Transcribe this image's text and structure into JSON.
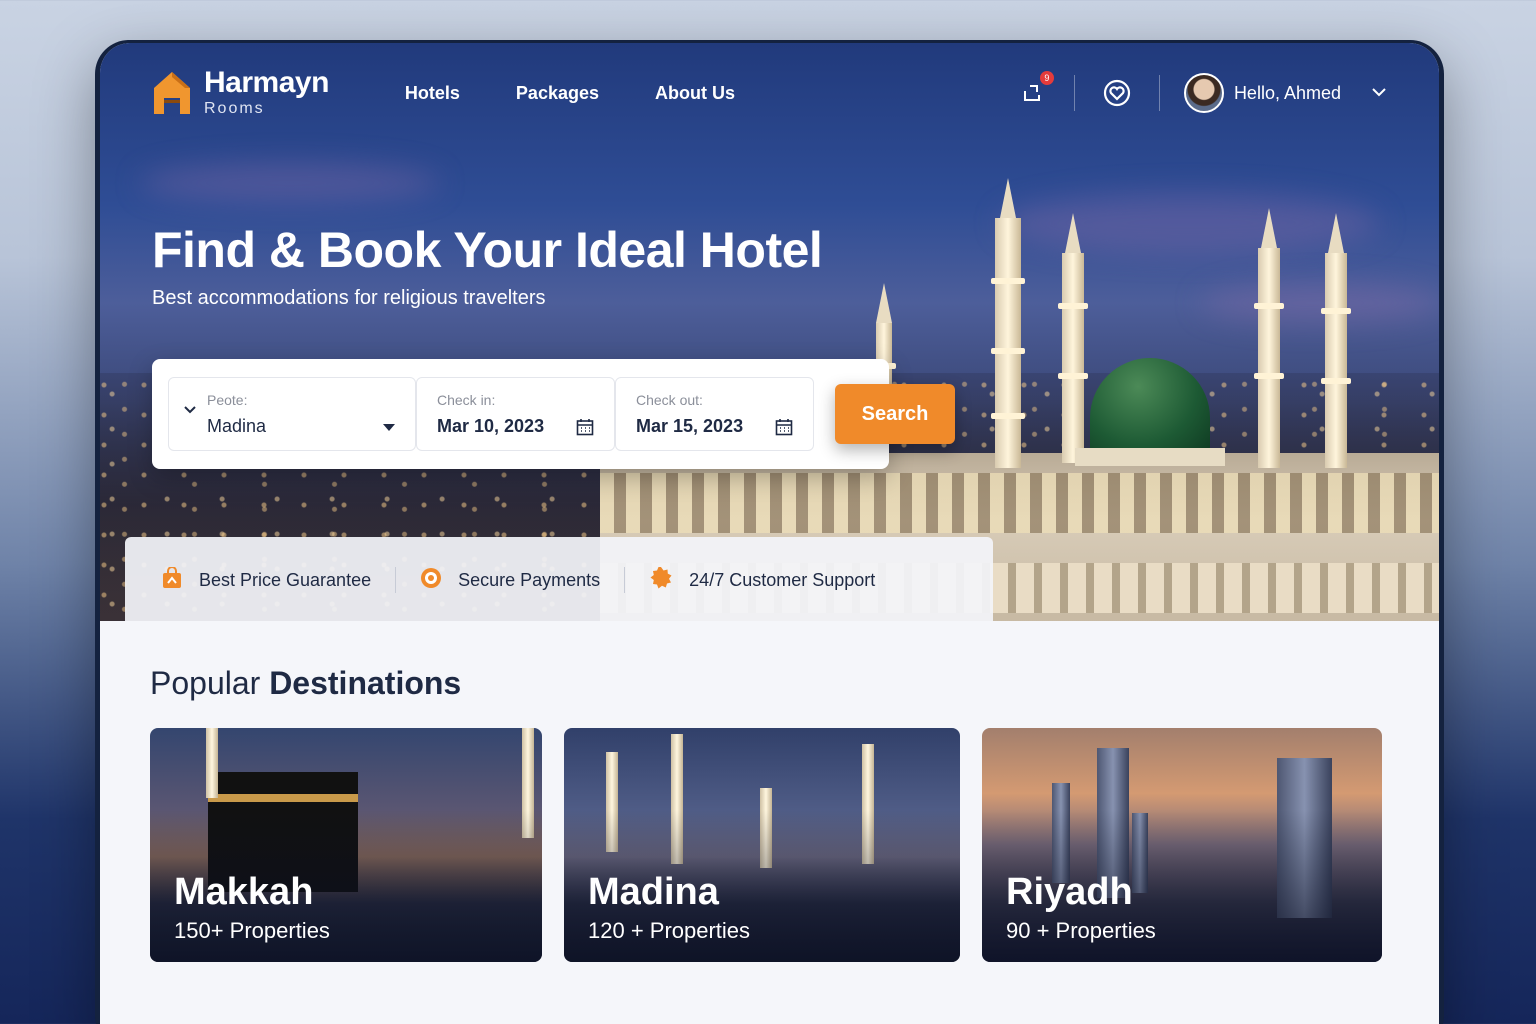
{
  "brand": {
    "name": "Harmayn",
    "sub": "Rooms"
  },
  "nav": {
    "items": [
      {
        "label": "Hotels"
      },
      {
        "label": "Packages"
      },
      {
        "label": "About Us"
      }
    ],
    "notification_count": "9",
    "user_greeting": "Hello, Ahmed",
    "icons": [
      "share-icon",
      "heart-icon",
      "chevron-down-icon"
    ]
  },
  "hero": {
    "title": "Find & Book Your Ideal Hotel",
    "subtitle": "Best accommodations for religious travelters"
  },
  "search": {
    "destination": {
      "label": "Peote:",
      "value": "Madina"
    },
    "check_in": {
      "label": "Check in:",
      "value": "Mar 10, 2023"
    },
    "check_out": {
      "label": "Check out:",
      "value": "Mar 15, 2023"
    },
    "button": "Search"
  },
  "features": [
    {
      "label": "Best Price Guarantee",
      "icon": "tag-icon"
    },
    {
      "label": "Secure Payments",
      "icon": "shield-icon"
    },
    {
      "label": "24/7 Customer Support",
      "icon": "support-icon"
    }
  ],
  "popular": {
    "title_light": "Popular ",
    "title_bold": "Destinations",
    "cards": [
      {
        "name": "Makkah",
        "count": "150+ Properties"
      },
      {
        "name": "Madina",
        "count": "120 + Properties"
      },
      {
        "name": "Riyadh",
        "count": "90 + Properties"
      }
    ]
  },
  "colors": {
    "accent": "#f08a2a",
    "navy": "#1f2a44",
    "dome": "#1d5a34"
  }
}
